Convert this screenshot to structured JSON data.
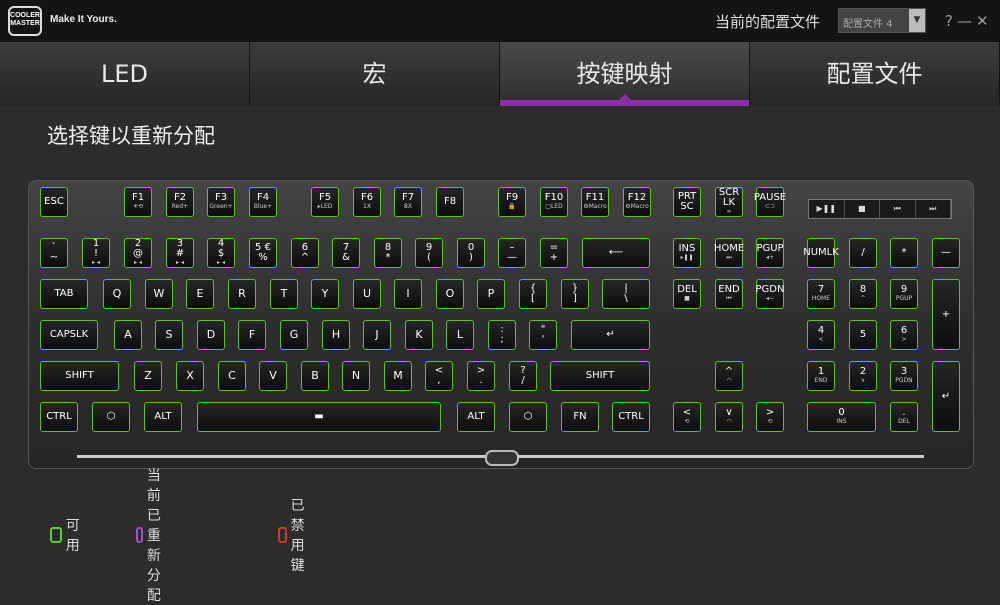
{
  "brand": {
    "logo_lines": [
      "COOLER",
      "MASTER"
    ],
    "tagline": "Make It Yours."
  },
  "profile": {
    "label": "当前的配置文件",
    "value": "配置文件 4",
    "arrow": "▼"
  },
  "window": {
    "help": "?",
    "minimize": "—",
    "close": "✕"
  },
  "tabs": [
    {
      "label": "LED"
    },
    {
      "label": "宏"
    },
    {
      "label": "按键映射"
    },
    {
      "label": "配置文件"
    }
  ],
  "section_title": "选择键以重新分配",
  "keys": {
    "esc": "ESC",
    "f1": "F1",
    "f2": "F2",
    "f3": "F3",
    "f4": "F4",
    "f5": "F5",
    "f6": "F6",
    "f7": "F7",
    "f8": "F8",
    "f9": "F9",
    "f10": "F10",
    "f11": "F11",
    "f12": "F12",
    "f1_sub": "☀⟲",
    "f2_sub": "Red+",
    "f3_sub": "Green+",
    "f4_sub": "Blue+",
    "f5_sub": "▸LED",
    "f6_sub": "1X",
    "f7_sub": "8X",
    "f9_sub": "🔒",
    "f10_sub": "▢LED",
    "f11_sub": "⚙Macro",
    "f12_sub": "⚙Macro",
    "prtsc": "PRT\nSC",
    "scrlk": "SCR\nLK",
    "pause": "PAUSE",
    "scrlk_sub": "∞",
    "pause_sub": "⊂⊃",
    "media": [
      "▶❚❚",
      "■",
      "⏮",
      "⏭"
    ],
    "grave": "`\n~",
    "n1": "1\n!",
    "n2": "2\n@",
    "n3": "3\n#",
    "n4": "4\n$",
    "n5": "5 €\n%",
    "n6": "6\n^",
    "n7": "7\n&",
    "n8": "8\n*",
    "n9": "9\n(",
    "n0": "0\n)",
    "minus": "–\n—",
    "equal": "=\n+",
    "backspace": "⟵",
    "n1_sub": "▸ ◂",
    "n2_sub": "▸ ◂",
    "n3_sub": "▸ ◂",
    "n4_sub": "▸ ◂",
    "ins": "INS",
    "home": "HOME",
    "pgup": "PGUP",
    "ins_sub": "▸❚❚",
    "home_sub": "⏭",
    "pgup_sub": "◂+",
    "numlk": "NUMLK",
    "numslash": "/",
    "numstar": "*",
    "numminus": "—",
    "tab": "TAB",
    "q": "Q",
    "w": "W",
    "e": "E",
    "r": "R",
    "t": "T",
    "y": "Y",
    "u": "U",
    "i": "I",
    "o": "O",
    "p": "P",
    "lbracket": "{\n[",
    "rbracket": "}\n]",
    "backslash": "|\n\\",
    "del": "DEL",
    "end": "END",
    "pgdn": "PGDN",
    "del_sub": "■",
    "end_sub": "⏮",
    "pgdn_sub": "◂−",
    "num7": "7",
    "num8": "8",
    "num9": "9",
    "num7_sub": "HOME",
    "num8_sub": "^",
    "num9_sub": "PGUP",
    "numplus": "+",
    "capslk": "CAPSLK",
    "a": "A",
    "s": "S",
    "d": "D",
    "f": "F",
    "g": "G",
    "h": "H",
    "j": "J",
    "k": "K",
    "l": "L",
    "semicolon": ":\n;",
    "quote": "\"\n'",
    "enter": "↵",
    "num4": "4",
    "num5": "5",
    "num6": "6",
    "num4_sub": "<",
    "num6_sub": ">",
    "lshift": "SHIFT",
    "z": "Z",
    "x": "X",
    "c": "C",
    "v": "V",
    "b": "B",
    "n": "N",
    "m": "M",
    "comma": "<\n,",
    "period": ">\n.",
    "slash": "?\n/",
    "rshift": "SHIFT",
    "up": "^",
    "up_sub": "◠",
    "num1": "1",
    "num2": "2",
    "num3": "3",
    "num1_sub": "END",
    "num2_sub": "∨",
    "num3_sub": "PGDN",
    "numenter": "↵",
    "lctrl": "CTRL",
    "lwin": "⬡",
    "lalt": "ALT",
    "space": "▬",
    "ralt": "ALT",
    "rwin": "⬡",
    "fn": "FN",
    "rctrl": "CTRL",
    "left": "<",
    "down": "∨",
    "right": ">",
    "left_sub": "⟲",
    "down_sub": "◠",
    "right_sub": "⟲",
    "num0": "0",
    "num0_sub": "INS",
    "numdel": ".",
    "numdel_sub": "DEL"
  },
  "legend": [
    {
      "label": "可用",
      "color": "#5fd12a"
    },
    {
      "label": "当前已重新分配",
      "color": "#a050c8"
    },
    {
      "label": "已禁用键",
      "color": "#e0302a"
    }
  ],
  "colors": {
    "accent": "#8b2fa8",
    "key_border": "#5fbf24"
  }
}
